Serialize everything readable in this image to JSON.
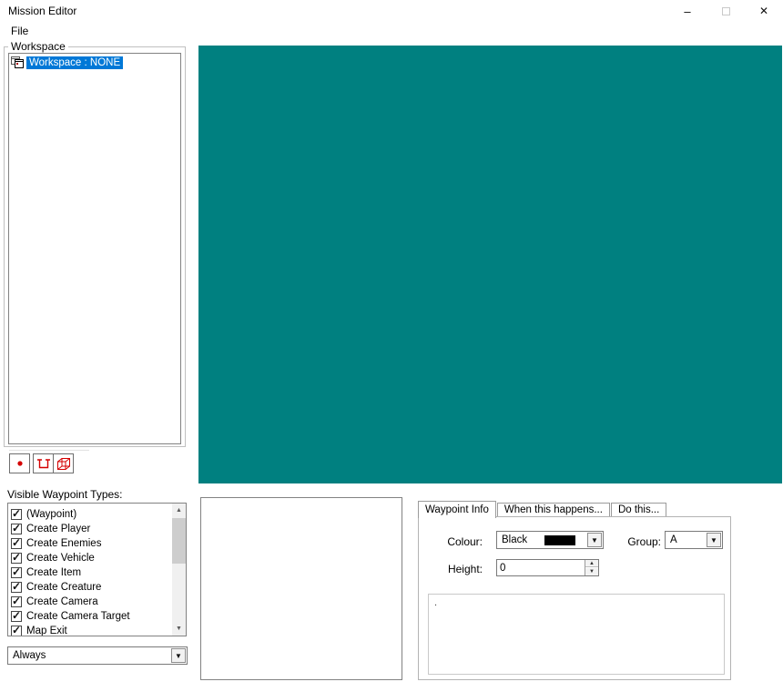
{
  "window": {
    "title": "Mission Editor"
  },
  "menu": {
    "file": "File"
  },
  "workspace": {
    "group_label": "Workspace",
    "selected_item": "Workspace : NONE"
  },
  "waypoint_types": {
    "label": "Visible Waypoint Types:",
    "items": [
      {
        "label": "(Waypoint)",
        "checked": true
      },
      {
        "label": "Create Player",
        "checked": true
      },
      {
        "label": "Create Enemies",
        "checked": true
      },
      {
        "label": "Create Vehicle",
        "checked": true
      },
      {
        "label": "Create Item",
        "checked": true
      },
      {
        "label": "Create Creature",
        "checked": true
      },
      {
        "label": "Create Camera",
        "checked": true
      },
      {
        "label": "Create Camera Target",
        "checked": true
      },
      {
        "label": "Map Exit",
        "checked": true
      }
    ]
  },
  "filter": {
    "value": "Always"
  },
  "tabs": [
    {
      "label": "Waypoint Info",
      "selected": true
    },
    {
      "label": "When this happens...",
      "selected": false
    },
    {
      "label": "Do this...",
      "selected": false
    }
  ],
  "waypoint_info": {
    "colour_label": "Colour:",
    "colour_value": "Black",
    "group_label": "Group:",
    "group_value": "A",
    "height_label": "Height:",
    "height_value": "0",
    "note": "."
  },
  "colors": {
    "viewport": "#008080",
    "selection": "#0078D7",
    "colour_swatch": "#000000",
    "tool_icon_red": "#D40000"
  }
}
